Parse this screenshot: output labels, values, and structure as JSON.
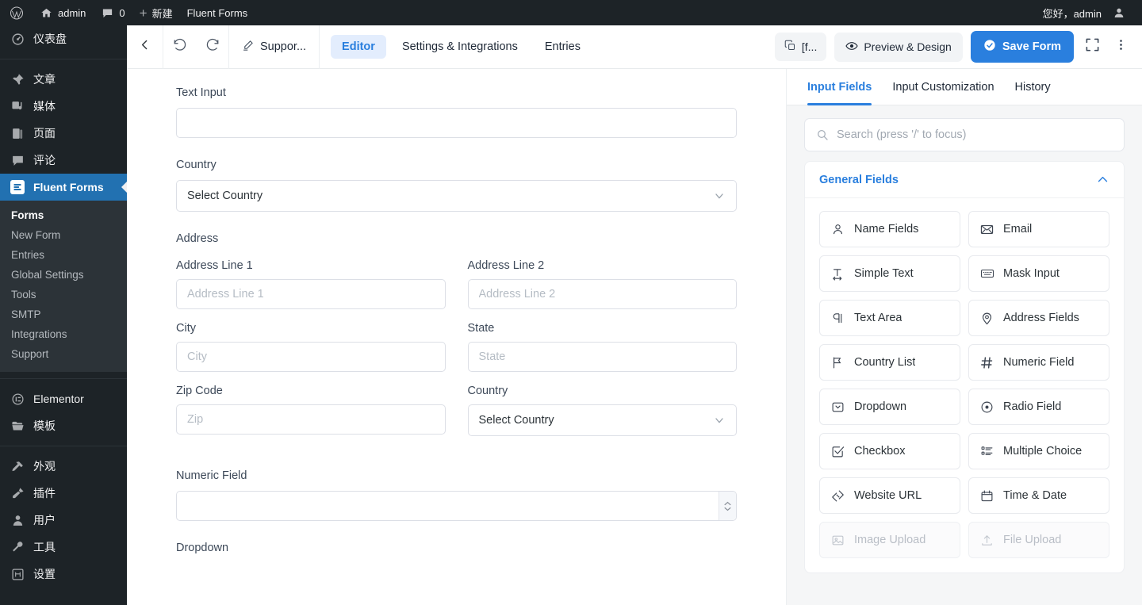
{
  "adminbar": {
    "logo_icon": "wordpress-icon",
    "site_icon": "home-icon",
    "site_label": "admin",
    "comments_icon": "comment-bubble-icon",
    "comments_count": "0",
    "new_icon": "plus-icon",
    "new_label": "新建",
    "plugin_label": "Fluent Forms",
    "greeting": "您好，admin",
    "avatar_icon": "user-avatar-icon"
  },
  "sidebar": {
    "items": [
      {
        "label": "仪表盘",
        "icon": "dashboard-icon",
        "active": false
      },
      {
        "label": "文章",
        "icon": "pin-icon",
        "active": false
      },
      {
        "label": "媒体",
        "icon": "media-icon",
        "active": false
      },
      {
        "label": "页面",
        "icon": "page-icon",
        "active": false
      },
      {
        "label": "评论",
        "icon": "comment-icon",
        "active": false
      },
      {
        "label": "Fluent Forms",
        "icon": "fluentforms-icon",
        "active": true
      }
    ],
    "submenu": [
      {
        "label": "Forms",
        "current": true
      },
      {
        "label": "New Form",
        "current": false
      },
      {
        "label": "Entries",
        "current": false
      },
      {
        "label": "Global Settings",
        "current": false
      },
      {
        "label": "Tools",
        "current": false
      },
      {
        "label": "SMTP",
        "current": false
      },
      {
        "label": "Integrations",
        "current": false
      },
      {
        "label": "Support",
        "current": false
      }
    ],
    "items2": [
      {
        "label": "Elementor",
        "icon": "elementor-icon"
      },
      {
        "label": "模板",
        "icon": "folder-icon"
      }
    ],
    "items3": [
      {
        "label": "外观",
        "icon": "appearance-icon"
      },
      {
        "label": "插件",
        "icon": "plugin-icon"
      },
      {
        "label": "用户",
        "icon": "users-icon"
      },
      {
        "label": "工具",
        "icon": "tools-icon"
      },
      {
        "label": "设置",
        "icon": "settings-icon"
      }
    ]
  },
  "toolbar": {
    "back_icon": "chevron-left-icon",
    "undo_icon": "undo-arrow-icon",
    "redo_icon": "redo-arrow-icon",
    "form_name_icon": "pencil-icon",
    "form_name": "Suppor...",
    "tabs": [
      {
        "label": "Editor",
        "active": true
      },
      {
        "label": "Settings & Integrations",
        "active": false
      },
      {
        "label": "Entries",
        "active": false
      }
    ],
    "shortcode_icon": "copy-icon",
    "shortcode_label": "[f...",
    "preview_icon": "eye-icon",
    "preview_label": "Preview & Design",
    "save_icon": "check-circle-icon",
    "save_label": "Save Form",
    "fullscreen_icon": "fullscreen-expand-icon",
    "more_icon": "more-vertical-icon"
  },
  "canvas": {
    "fields": [
      {
        "label": "Text Input",
        "type": "text",
        "placeholder": "",
        "value": ""
      },
      {
        "label": "Country",
        "type": "select",
        "value": "Select Country"
      }
    ],
    "address": {
      "label": "Address",
      "line1_label": "Address Line 1",
      "line1_placeholder": "Address Line 1",
      "line2_label": "Address Line 2",
      "line2_placeholder": "Address Line 2",
      "city_label": "City",
      "city_placeholder": "City",
      "state_label": "State",
      "state_placeholder": "State",
      "zip_label": "Zip Code",
      "zip_placeholder": "Zip",
      "country_label": "Country",
      "country_value": "Select Country"
    },
    "numeric": {
      "label": "Numeric Field",
      "placeholder": "",
      "value": ""
    },
    "dropdown": {
      "label": "Dropdown"
    }
  },
  "right_panel": {
    "tabs": [
      {
        "label": "Input Fields",
        "active": true
      },
      {
        "label": "Input Customization",
        "active": false
      },
      {
        "label": "History",
        "active": false
      }
    ],
    "search": {
      "placeholder": "Search (press '/' to focus)",
      "value": "",
      "icon": "search-icon"
    },
    "section": {
      "title": "General Fields",
      "collapse_icon": "chevron-up-icon",
      "fields": [
        {
          "label": "Name Fields",
          "icon": "person-icon",
          "disabled": false
        },
        {
          "label": "Email",
          "icon": "envelope-icon",
          "disabled": false
        },
        {
          "label": "Simple Text",
          "icon": "text-width-icon",
          "disabled": false
        },
        {
          "label": "Mask Input",
          "icon": "keyboard-icon",
          "disabled": false
        },
        {
          "label": "Text Area",
          "icon": "paragraph-icon",
          "disabled": false
        },
        {
          "label": "Address Fields",
          "icon": "map-pin-icon",
          "disabled": false
        },
        {
          "label": "Country List",
          "icon": "flag-icon",
          "disabled": false
        },
        {
          "label": "Numeric Field",
          "icon": "hash-icon",
          "disabled": false
        },
        {
          "label": "Dropdown",
          "icon": "dropdown-box-icon",
          "disabled": false
        },
        {
          "label": "Radio Field",
          "icon": "radio-circle-icon",
          "disabled": false
        },
        {
          "label": "Checkbox",
          "icon": "checkbox-icon",
          "disabled": false
        },
        {
          "label": "Multiple Choice",
          "icon": "list-icon",
          "disabled": false
        },
        {
          "label": "Website URL",
          "icon": "link-diamond-icon",
          "disabled": false
        },
        {
          "label": "Time & Date",
          "icon": "calendar-icon",
          "disabled": false
        },
        {
          "label": "Image Upload",
          "icon": "image-icon",
          "disabled": true
        },
        {
          "label": "File Upload",
          "icon": "upload-icon",
          "disabled": true
        }
      ]
    }
  },
  "colors": {
    "wp_dark": "#1d2327",
    "wp_submenu": "#2c3338",
    "wp_active_blue": "#2271b1",
    "accent_blue": "#2a7fde",
    "tab_pill": "#e3edfd",
    "panel_bg": "#f5f6f7"
  }
}
